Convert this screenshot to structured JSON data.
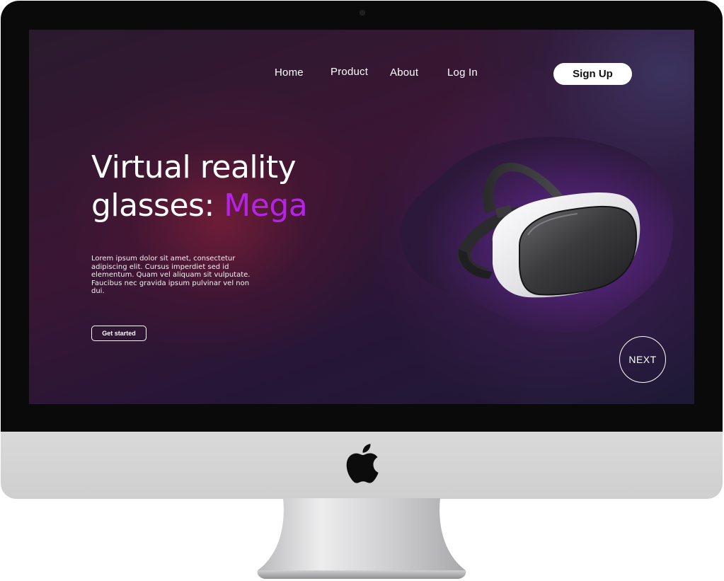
{
  "nav": {
    "home": "Home",
    "product": "Product",
    "about": "About",
    "login": "Log In",
    "signup": "Sign Up"
  },
  "hero": {
    "title_line1": "Virtual reality",
    "title_line2_prefix": "glasses: ",
    "title_accent": "Mega",
    "description": "Lorem ipsum dolor sit amet, consectetur adipiscing elit. Cursus imperdiet sed id elementum. Quam vel aliquam sit vulputate. Faucibus nec gravida ipsum pulvinar vel non dui.",
    "cta_label": "Get started"
  },
  "next_button": "NEXT",
  "icons": {
    "brand_logo": "apple-logo-icon",
    "product_image": "vr-headset-icon"
  },
  "colors": {
    "accent": "#b524e6",
    "screen_base": "#2a1a2e",
    "button_bg": "#ffffff"
  }
}
